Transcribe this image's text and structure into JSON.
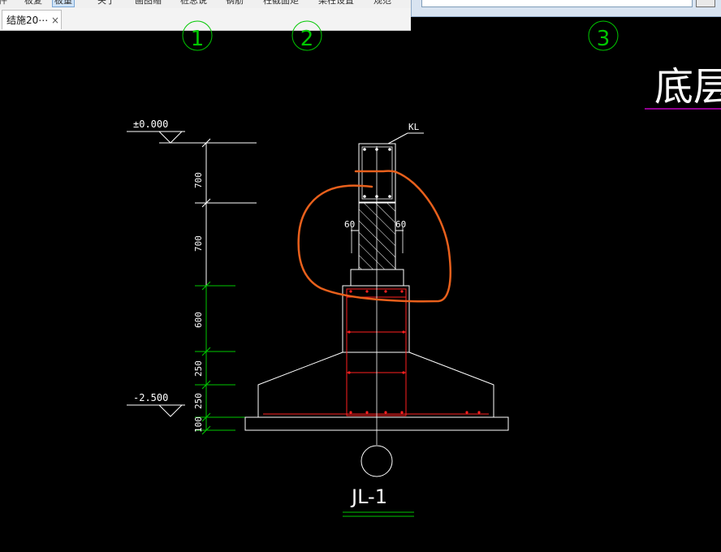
{
  "menu": {
    "items": [
      {
        "label": "件"
      },
      {
        "label": "板复"
      },
      {
        "label": "板量",
        "active": true
      },
      {
        "label": "关于"
      },
      {
        "label": "画图缩"
      },
      {
        "label": "桩总说"
      },
      {
        "label": "钢筋"
      },
      {
        "label": "柱截面矩"
      },
      {
        "label": "梁柱设置"
      },
      {
        "label": "规范"
      }
    ]
  },
  "tabs": {
    "drawing_tab": "结施20⋯",
    "close_glyph": "×"
  },
  "drawing": {
    "axis_labels": [
      "1",
      "2",
      "3"
    ],
    "title_fragment": "底层平",
    "elevations": {
      "top": "±0.000",
      "bottom": "-2.500"
    },
    "dimensions": [
      "700",
      "700",
      "600",
      "250",
      "250",
      "100"
    ],
    "beam_label": "KL",
    "offsets": [
      "60",
      "60"
    ],
    "detail_label": "JL-1"
  },
  "colors": {
    "background": "#000000",
    "line": "#ffffff",
    "axis": "#00c800",
    "rebar": "#ff2020",
    "markup": "#e8601c",
    "title_underline": "#c000c0"
  }
}
